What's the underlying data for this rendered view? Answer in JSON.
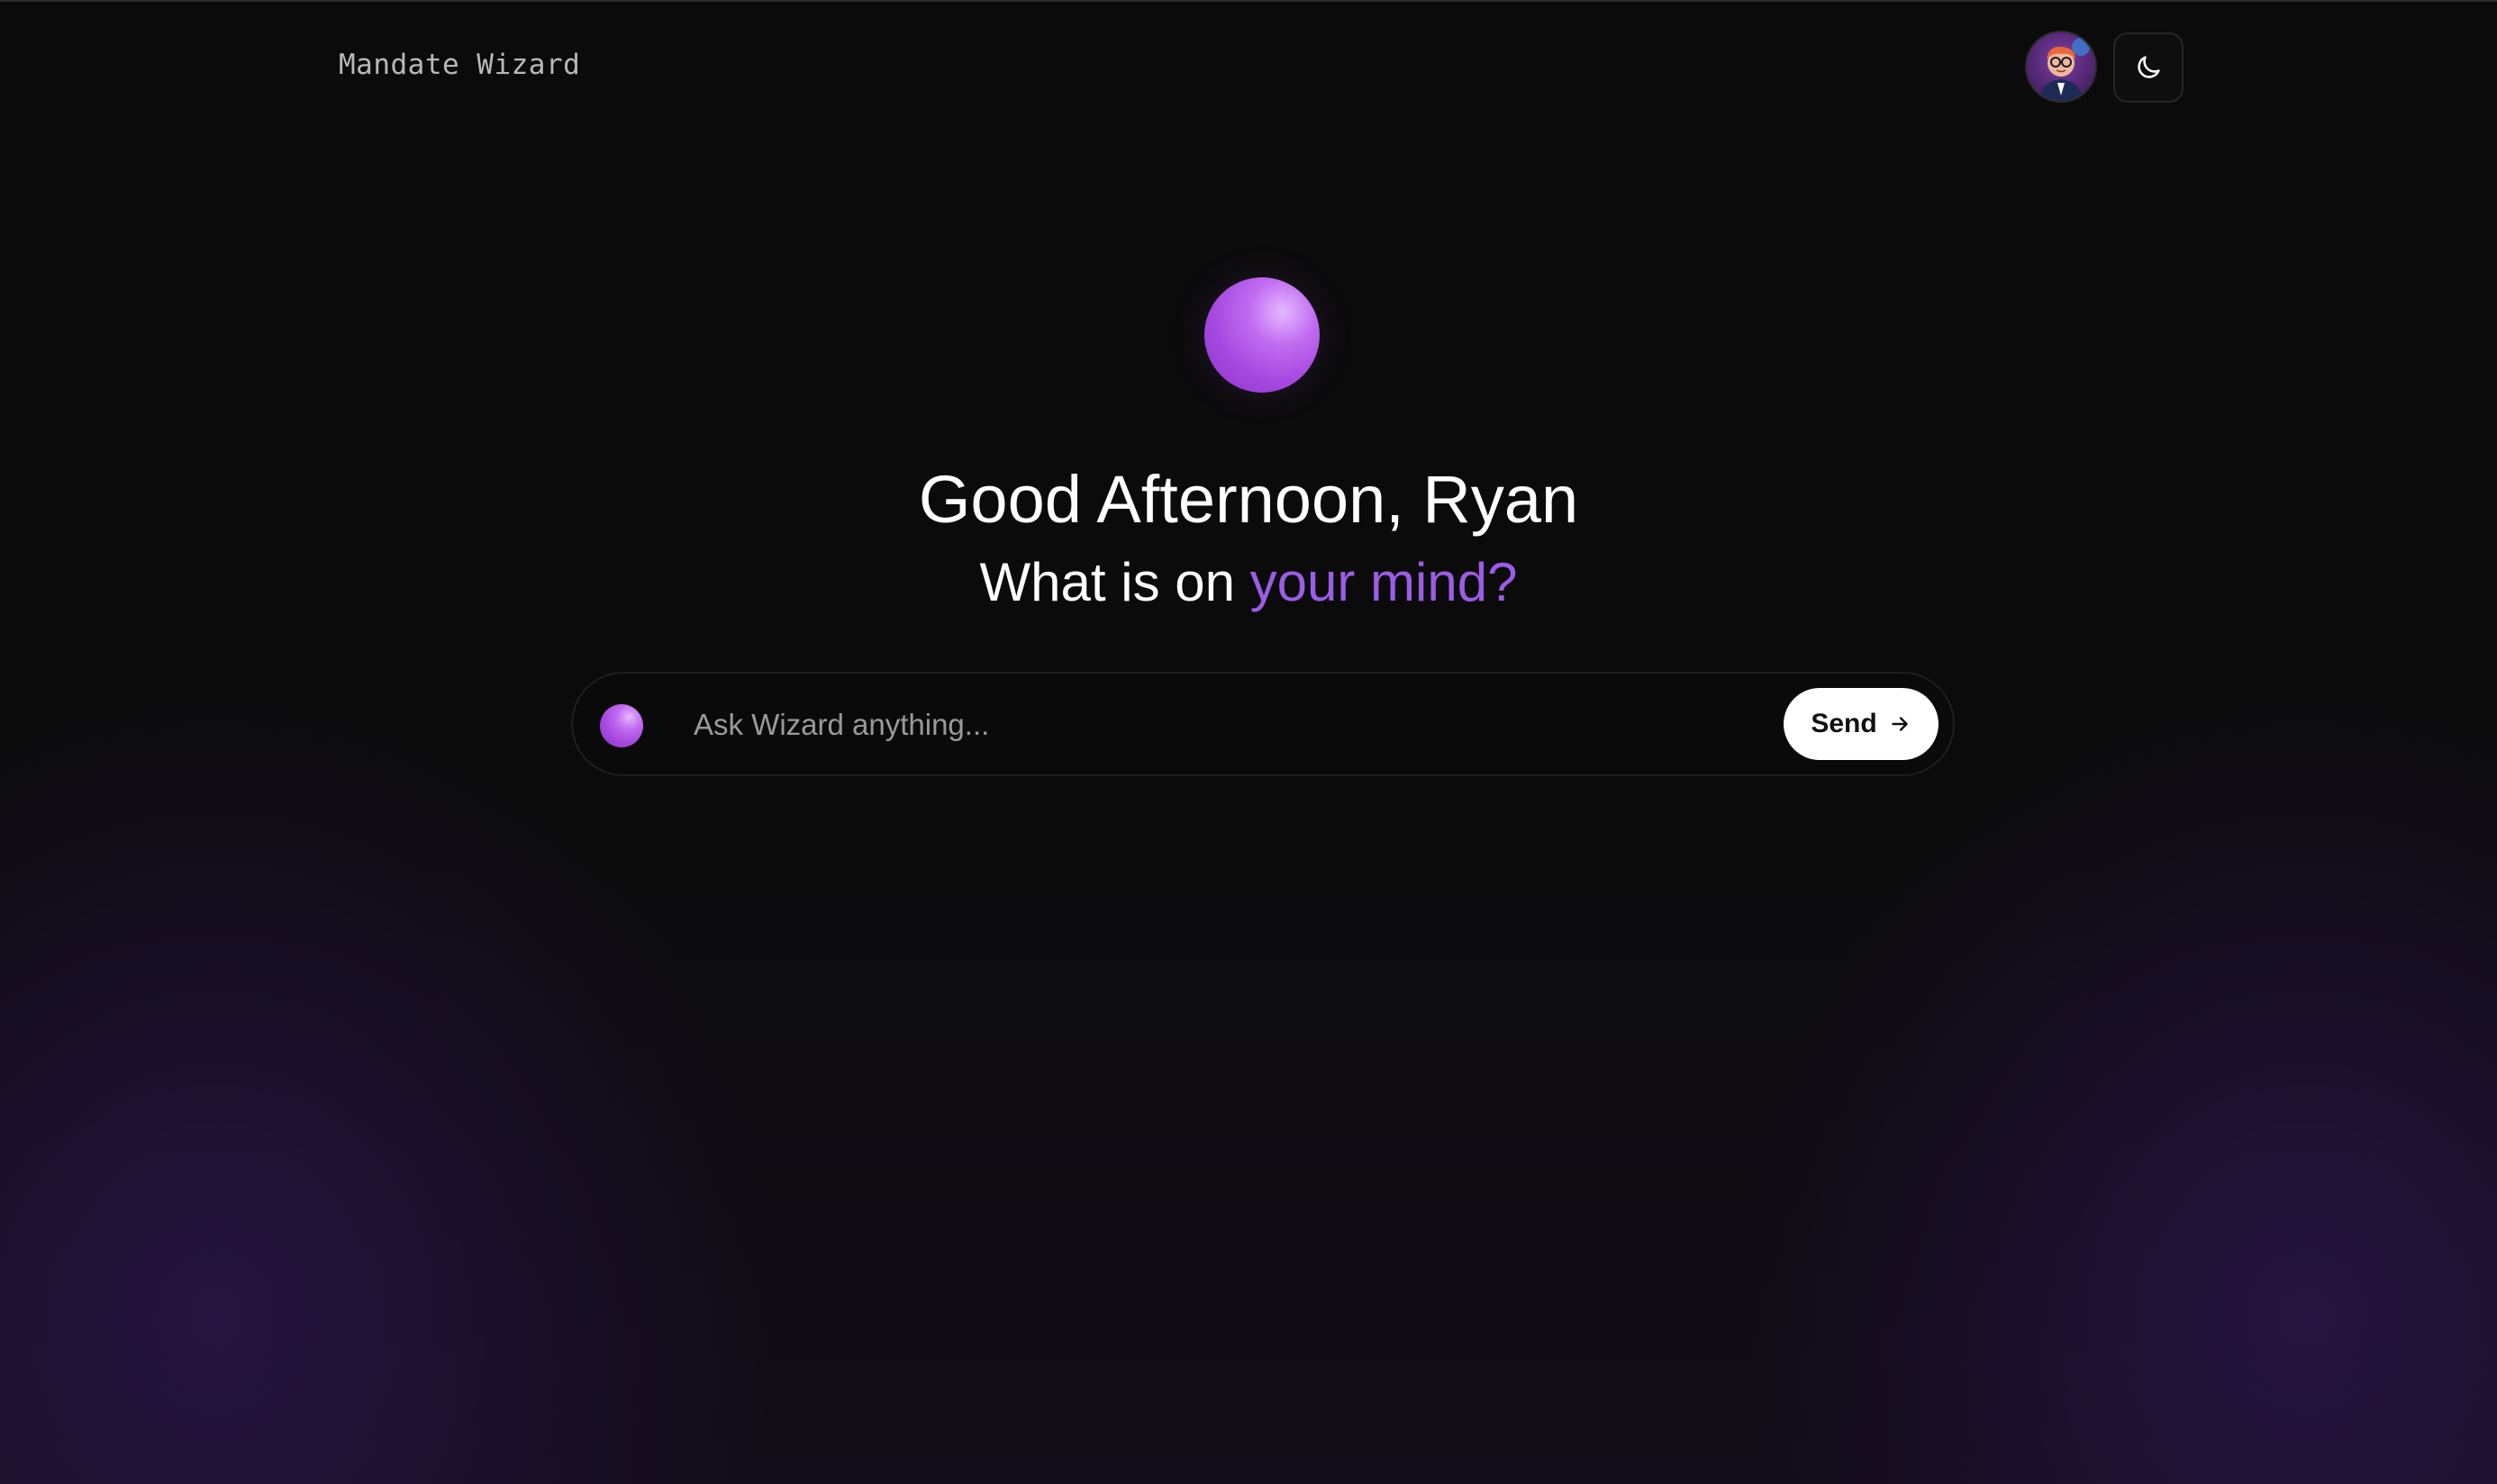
{
  "header": {
    "brand": "Mandate Wizard",
    "avatar_icon": "user-avatar",
    "theme_toggle_icon": "moon-icon"
  },
  "hero": {
    "greeting": "Good Afternoon, Ryan",
    "subline_prefix": "What is on ",
    "subline_accent": "your mind?"
  },
  "search": {
    "placeholder": "Ask Wizard anything...",
    "value": "",
    "send_label": "Send",
    "send_icon": "arrow-right-icon"
  },
  "colors": {
    "background": "#0b0b0b",
    "accent": "#9b5de5",
    "orb": "#a648e0",
    "send_button_bg": "#ffffff"
  }
}
